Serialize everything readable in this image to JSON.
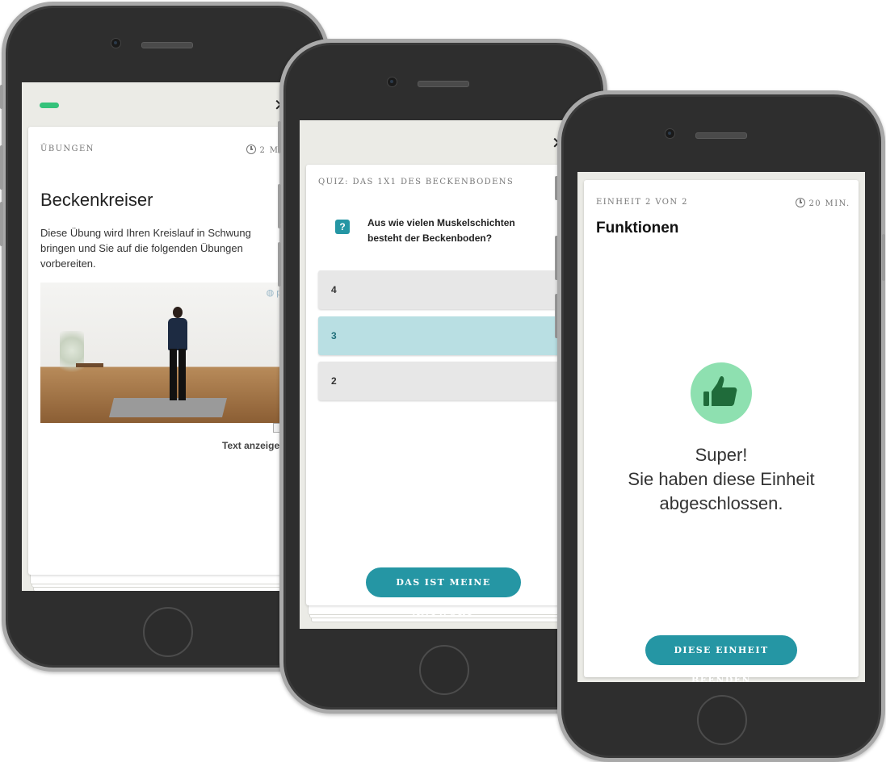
{
  "phone1": {
    "header": {
      "close_icon": "close-x"
    },
    "card": {
      "category": "Übungen",
      "duration": "2 MI",
      "title": "Beckenkreiser",
      "description": "Diese Übung wird Ihren Kreislauf in Schwung bringen und Sie auf die folgenden Übungen vorbereiten.",
      "video_watermark": "pelvin",
      "show_text_label": "Text anzeige"
    },
    "progress_color": "#34c27a"
  },
  "phone2": {
    "header": {
      "close_icon": "close-x"
    },
    "card": {
      "quiz_title": "Quiz: das 1x1 des Beckenbodens",
      "question_icon": "?",
      "question": "Aus wie vielen Muskelschichten besteht der Beckenboden?",
      "options": [
        {
          "label": "4",
          "selected": false
        },
        {
          "label": "3",
          "selected": true
        },
        {
          "label": "2",
          "selected": false
        }
      ],
      "submit_label": "Das ist meine Antwort"
    }
  },
  "phone3": {
    "card": {
      "unit_label": "Einheit 2 von 2",
      "duration": "20 MIN.",
      "title": "Funktionen",
      "success_line1": "Super!",
      "success_line2": "Sie haben diese Einheit",
      "success_line3": "abgeschlossen.",
      "finish_label": "Diese Einheit beenden",
      "thumb_icon": "thumbs-up"
    },
    "accent_color": "#2596a4",
    "success_circle_color": "#8ee0b0",
    "thumb_color": "#1f6b3a"
  }
}
